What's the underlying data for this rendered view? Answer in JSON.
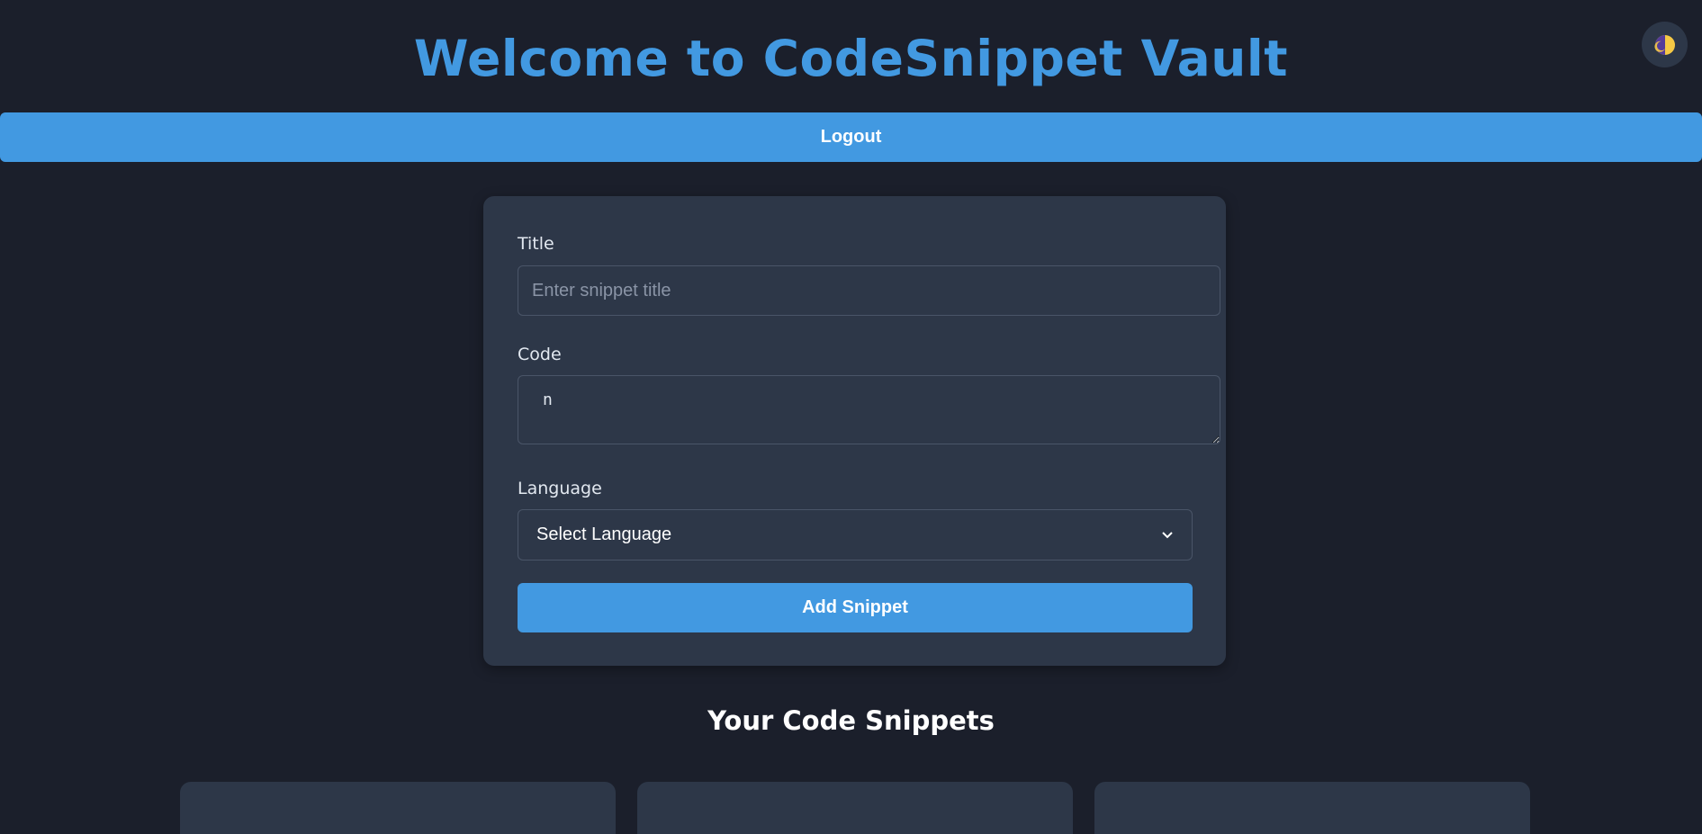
{
  "header": {
    "title": "Welcome to CodeSnippet Vault",
    "logout_label": "Logout",
    "theme_toggle_icon": "half-moon-icon"
  },
  "form": {
    "title_label": "Title",
    "title_placeholder": "Enter snippet title",
    "title_value": "",
    "code_label": "Code",
    "code_value": "n",
    "language_label": "Language",
    "language_selected": "Select Language",
    "add_label": "Add Snippet"
  },
  "snippets": {
    "section_title": "Your Code Snippets"
  },
  "colors": {
    "background": "#1b1f2b",
    "card": "#2d3748",
    "accent": "#4299e1",
    "border": "#4a5568"
  }
}
